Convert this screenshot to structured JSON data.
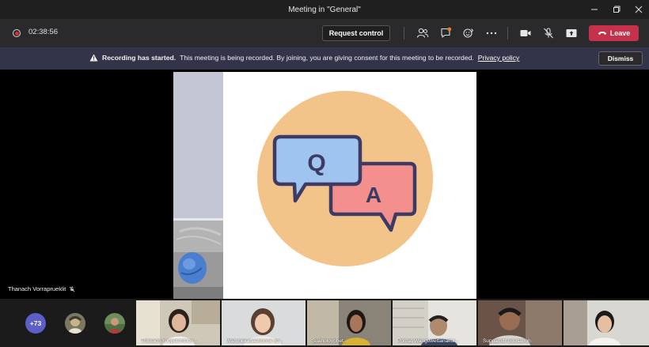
{
  "window": {
    "title": "Meeting in \"General\""
  },
  "toolbar": {
    "timer": "02:38:56",
    "request_control_label": "Request control",
    "leave_label": "Leave"
  },
  "banner": {
    "heading": "Recording has started.",
    "message": "This meeting is being recorded. By joining, you are giving consent for this meeting to be recorded.",
    "link_text": "Privacy policy",
    "dismiss_label": "Dismiss"
  },
  "shared_content": {
    "letter_q": "Q",
    "letter_a": "A"
  },
  "presenter": {
    "name": "Thanach Vorraprueklit"
  },
  "gallery": {
    "more_count": "+73",
    "participants": [
      {
        "name": "Thitirach Yoopetchthon..."
      },
      {
        "name": "Warunekanachonoe (G..."
      },
      {
        "name": "Suanployphet..."
      },
      {
        "name": "Pornat Wanguwettanakul..."
      },
      {
        "name": "Suppamitr Bousanoh"
      },
      {
        "name": ""
      }
    ]
  },
  "colors": {
    "leave_red": "#c4314b",
    "banner_bg": "#33344a",
    "badge_purple": "#5b5fc7",
    "qa_circle": "#f3c48a",
    "bubble_q": "#9fc4ef",
    "bubble_a": "#f3908e",
    "bubble_outline": "#3d3a63"
  }
}
